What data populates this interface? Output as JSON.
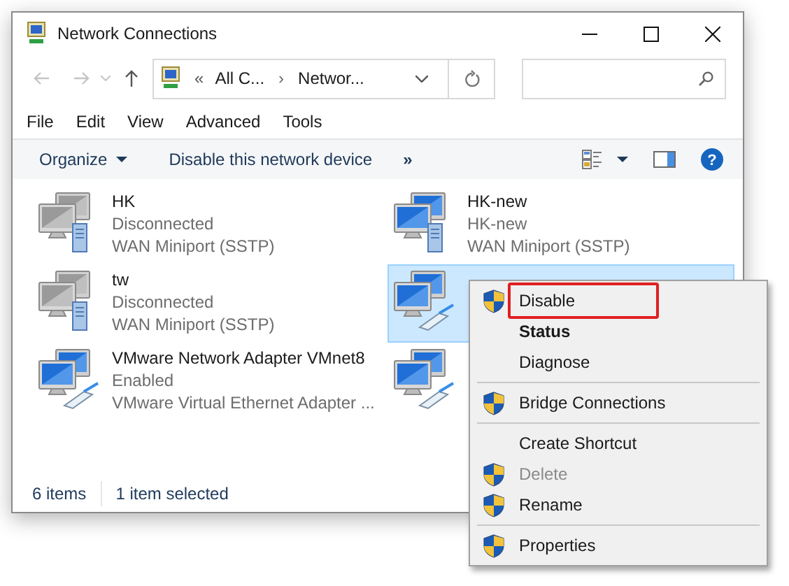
{
  "window": {
    "title": "Network Connections"
  },
  "address_bar": {
    "overflow": "«",
    "crumbs": [
      "All C...",
      "Networ..."
    ],
    "separator": "›"
  },
  "menu_bar": [
    "File",
    "Edit",
    "View",
    "Advanced",
    "Tools"
  ],
  "command_bar": {
    "organize": "Organize",
    "disable": "Disable this network device",
    "more": "»",
    "help": "?"
  },
  "connections": [
    {
      "name": "HK",
      "status": "Disconnected",
      "device": "WAN Miniport (SSTP)",
      "kind": "wan",
      "connected": false,
      "selected": false
    },
    {
      "name": "HK-new",
      "status": "HK-new",
      "device": "WAN Miniport (SSTP)",
      "kind": "wan",
      "connected": true,
      "selected": false
    },
    {
      "name": "tw",
      "status": "Disconnected",
      "device": "WAN Miniport (SSTP)",
      "kind": "wan",
      "connected": false,
      "selected": false
    },
    {
      "kind": "ethernet",
      "connected": true,
      "selected": true
    },
    {
      "name": "VMware Network Adapter VMnet8",
      "status": "Enabled",
      "device": "VMware Virtual Ethernet Adapter ...",
      "kind": "ethernet",
      "connected": true,
      "selected": false
    },
    {
      "kind": "ethernet",
      "connected": true,
      "selected": false
    }
  ],
  "status_bar": [
    "6 items",
    "1 item selected"
  ],
  "context_menu": [
    {
      "kind": "item",
      "label": "Disable",
      "shield": true,
      "bold": false,
      "disabled": false,
      "highlighted": true
    },
    {
      "kind": "item",
      "label": "Status",
      "shield": false,
      "bold": true,
      "disabled": false,
      "highlighted": false
    },
    {
      "kind": "item",
      "label": "Diagnose",
      "shield": false,
      "bold": false,
      "disabled": false,
      "highlighted": false
    },
    {
      "kind": "separator"
    },
    {
      "kind": "item",
      "label": "Bridge Connections",
      "shield": true,
      "bold": false,
      "disabled": false,
      "highlighted": false
    },
    {
      "kind": "separator"
    },
    {
      "kind": "item",
      "label": "Create Shortcut",
      "shield": false,
      "bold": false,
      "disabled": false,
      "highlighted": false
    },
    {
      "kind": "item",
      "label": "Delete",
      "shield": true,
      "bold": false,
      "disabled": true,
      "highlighted": false
    },
    {
      "kind": "item",
      "label": "Rename",
      "shield": true,
      "bold": false,
      "disabled": false,
      "highlighted": false
    },
    {
      "kind": "separator"
    },
    {
      "kind": "item",
      "label": "Properties",
      "shield": true,
      "bold": false,
      "disabled": false,
      "highlighted": false
    }
  ]
}
